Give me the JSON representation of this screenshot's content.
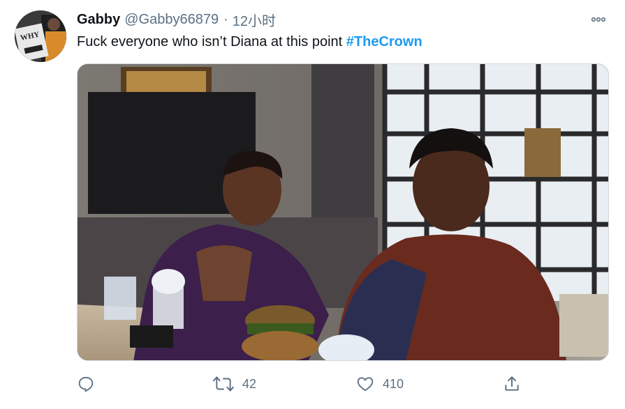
{
  "tweet": {
    "display_name": "Gabby",
    "handle": "@Gabby66879",
    "separator": "·",
    "time": "12小时",
    "text": "Fuck everyone who isn’t Diana at this point ",
    "hashtag": "#TheCrown",
    "avatar_sign_text": "WHY"
  },
  "actions": {
    "retweets": "42",
    "likes": "410"
  },
  "colors": {
    "accent": "#1d9bf0",
    "secondary_text": "#5b7083",
    "primary_text": "#0f1419"
  },
  "icons": [
    "more-icon",
    "reply-icon",
    "retweet-icon",
    "like-icon",
    "share-icon"
  ]
}
